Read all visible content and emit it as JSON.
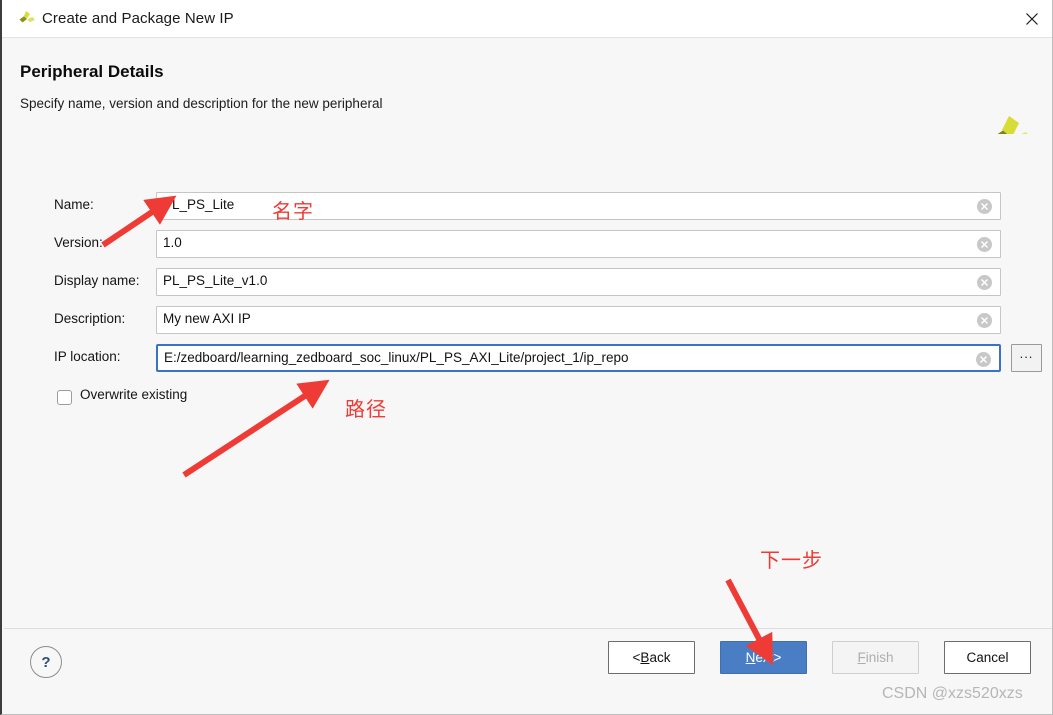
{
  "window": {
    "title": "Create and Package New IP",
    "logo_icon": "vivado-logo-icon",
    "close_icon": "close-icon"
  },
  "header": {
    "title": "Peripheral Details",
    "subtitle": "Specify name, version and description for the new peripheral",
    "brand_logo_icon": "xilinx-logo-icon"
  },
  "form": {
    "fields": [
      {
        "label": "Name:",
        "value": "PL_PS_Lite",
        "focused": false,
        "clear_icon": "clear-circle-icon"
      },
      {
        "label": "Version:",
        "value": "1.0",
        "focused": false,
        "clear_icon": "clear-circle-icon"
      },
      {
        "label": "Display name:",
        "value": "PL_PS_Lite_v1.0",
        "focused": false,
        "clear_icon": "clear-circle-icon"
      },
      {
        "label": "Description:",
        "value": "My new AXI IP",
        "focused": false,
        "clear_icon": "clear-circle-icon"
      },
      {
        "label": "IP location:",
        "value": "E:/zedboard/learning_zedboard_soc_linux/PL_PS_AXI_Lite/project_1/ip_repo",
        "focused": true,
        "clear_icon": "clear-circle-icon"
      }
    ],
    "browse_label": "...",
    "overwrite": {
      "label": "Overwrite existing",
      "checked": false
    }
  },
  "annotations": {
    "color": "#ef3b36",
    "items": [
      {
        "text": "名字",
        "meaning": "name"
      },
      {
        "text": "路径",
        "meaning": "path"
      },
      {
        "text": "下一步",
        "meaning": "next-step"
      }
    ]
  },
  "footer": {
    "help_label": "?",
    "buttons": [
      {
        "name": "back",
        "prefix": "< ",
        "accel": "B",
        "rest": "ack",
        "suffix": "",
        "state": "enabled"
      },
      {
        "name": "next",
        "prefix": "",
        "accel": "N",
        "rest": "ext",
        "suffix": " >",
        "state": "primary"
      },
      {
        "name": "finish",
        "prefix": "",
        "accel": "F",
        "rest": "inish",
        "suffix": "",
        "state": "disabled"
      },
      {
        "name": "cancel",
        "prefix": "",
        "accel": "",
        "rest": "Cancel",
        "suffix": "",
        "state": "enabled"
      }
    ],
    "watermark": "CSDN @xzs520xzs"
  },
  "colors": {
    "accent_blue": "#4a7ec4",
    "focus_blue": "#3a72c8",
    "annotation_red": "#ef3b36",
    "background": "#f7f7f7"
  }
}
